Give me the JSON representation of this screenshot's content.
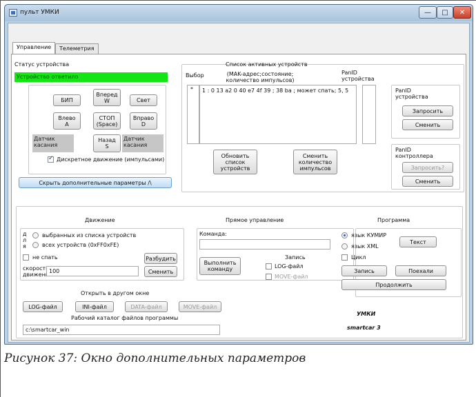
{
  "window": {
    "title": "пульт УМКИ",
    "min": "—",
    "max": "□",
    "close": "✕"
  },
  "tabs": [
    {
      "label": "Управление"
    },
    {
      "label": "Телеметрия"
    }
  ],
  "device_status": {
    "label": "Статус устройства",
    "value": "Устройство ответило"
  },
  "control_buttons": {
    "beep": "БИП",
    "forward": "Вперед\nW",
    "light": "Свет",
    "left": "Влево\nA",
    "stop": "СТОП\n(Space)",
    "right": "Вправо\nD",
    "touch_left": "Датчик\nкасания",
    "back": "Назад\nS",
    "touch_right": "Датчик\nкасания",
    "discrete_label": "Дискретное движение (импульсами)",
    "hide_params": "Скрыть дополнительные параметры /\\"
  },
  "devices": {
    "title": "Список активных устройств",
    "col_select": "Выбор",
    "col_mac": "(MAK-адрес;состояние;\nколичество импульсов)",
    "col_panid": "PanID\nустройства",
    "row_marker": "*",
    "row_text": "1 : 0 13 a2 0 40 e7 4f 39 ; 38 ba ; может спать; 5, 5",
    "refresh_button": "Обновить\nсписок\nустройств",
    "change_pulses_button": "Сменить\nколичество\nимпульсов"
  },
  "panid_device": {
    "label": "PanID\nустройства",
    "request": "Запросить",
    "change": "Сменить"
  },
  "panid_controller": {
    "label": "PanID\nконтроллера",
    "request": "Запросить?",
    "change": "Сменить"
  },
  "motion": {
    "title": "Движение",
    "side_letters": "д\nл\nя",
    "opt_selected": "выбранных из списка устройств",
    "opt_all": "всех устройств (0xFF0xFE)",
    "no_sleep": "не спать",
    "wake_button": "Разбудить",
    "speed_label": "скорость\nдвижения",
    "speed_value": "100",
    "change_button": "Сменить"
  },
  "direct": {
    "title": "Прямое управление",
    "command_label": "Команда:",
    "command_value": "",
    "record_label": "Запись",
    "execute_button": "Выполнить\nкоманду",
    "log_file": "LOG-файл",
    "move_file": "MOVE-файл"
  },
  "program": {
    "title": "Программа",
    "lang_kumir": "язык КУМИР",
    "lang_xml": "язык XML",
    "text_button": "Текст",
    "loop": "Цикл",
    "record_button": "Запись",
    "go_button": "Поехали",
    "continue_button": "Продолжить"
  },
  "open_window": {
    "title": "Открыть в другом окне",
    "log": "LOG-файл",
    "ini": "INI-файл",
    "data": "DATA-файл",
    "move": "MOVE-файл"
  },
  "workdir": {
    "label": "Рабочий каталог файлов программы",
    "value": "c:\\smartcar_win"
  },
  "branding": {
    "line1": "УМКИ",
    "line2": "smartcar 3"
  },
  "caption": "Рисунок 37: Окно дополнительных параметров",
  "colors": {
    "status_green": "#13e613",
    "accent_blue": "#bfdcf3"
  }
}
